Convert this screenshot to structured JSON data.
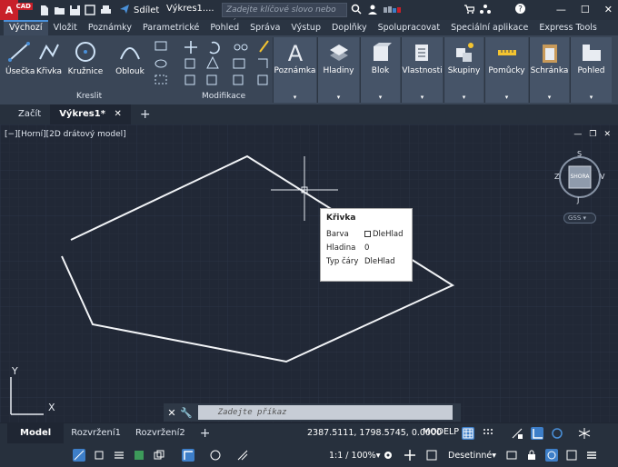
{
  "app": {
    "logo_text": "A",
    "logo_sub": "CAD",
    "share_label": "Sdílet",
    "doc_title": "Výkres1....",
    "search_placeholder": "Zadejte klíčové slovo nebo výraz"
  },
  "ribbon_tabs": [
    {
      "label": "Výchozí",
      "active": true
    },
    {
      "label": "Vložit"
    },
    {
      "label": "Poznámky"
    },
    {
      "label": "Parametrické"
    },
    {
      "label": "Pohled"
    },
    {
      "label": "Správa"
    },
    {
      "label": "Výstup"
    },
    {
      "label": "Doplňky"
    },
    {
      "label": "Spolupracovat"
    },
    {
      "label": "Speciální aplikace"
    },
    {
      "label": "Express Tools"
    }
  ],
  "ribbon": {
    "draw_tools": [
      "Úsečka",
      "Křivka",
      "Kružnice",
      "Oblouk"
    ],
    "draw_panel": "Kreslit",
    "modify_panel": "Modifikace",
    "big_buttons": [
      "Poznámka",
      "Hladiny",
      "Blok",
      "Vlastnosti",
      "Skupiny",
      "Pomůcky",
      "Schránka",
      "Pohled"
    ]
  },
  "file_tabs": {
    "start": "Začít",
    "drawing": "Výkres1*",
    "add": "+"
  },
  "viewport": {
    "label": "[−][Horní][2D drátový model]",
    "viewcube_top": "SHORA",
    "compass": {
      "n": "S",
      "s": "J",
      "w": "Z",
      "e": "V"
    },
    "gss": "GSS",
    "axis_x": "X",
    "axis_y": "Y"
  },
  "tooltip": {
    "title": "Křivka",
    "rows": [
      {
        "key": "Barva",
        "value": "DleHlad",
        "swatch": true
      },
      {
        "key": "Hladina",
        "value": "0"
      },
      {
        "key": "Typ čáry",
        "value": "DleHlad"
      }
    ]
  },
  "command_line": {
    "placeholder": "Zadejte příkaz"
  },
  "layout_tabs": [
    "Model",
    "Rozvržení1",
    "Rozvržení2"
  ],
  "status": {
    "coordinates": "2387.5111, 1798.5745, 0.0000",
    "space": "MODELP",
    "scale": "1:1 / 100%",
    "units": "Desetinné"
  },
  "colors": {
    "accent": "#4a90d9",
    "logo": "#c8202a",
    "viewport_bg": "#212836"
  }
}
